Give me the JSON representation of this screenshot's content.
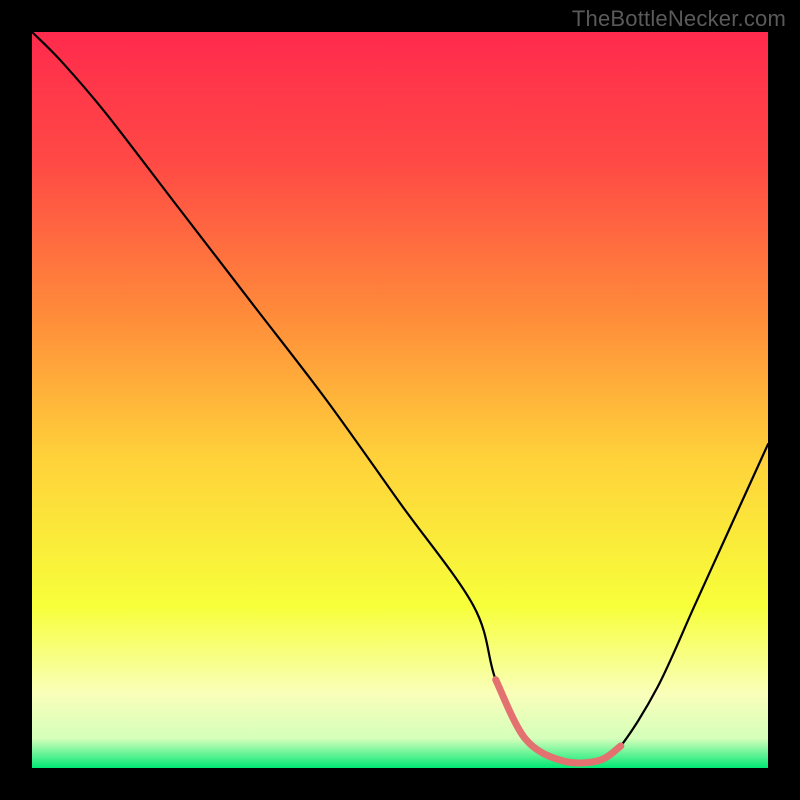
{
  "watermark": "TheBottleNecker.com",
  "colors": {
    "bg": "#000000",
    "gradient_top": "#ff2a4d",
    "gradient_mid_upper": "#ff6a3a",
    "gradient_mid": "#ffd23a",
    "gradient_lower": "#f7ff3a",
    "gradient_bottom_yellow": "#f9ffba",
    "gradient_bottom_green": "#00e874",
    "curve": "#000000",
    "emphasis": "#e2716f"
  },
  "chart_data": {
    "type": "line",
    "title": "",
    "xlabel": "",
    "ylabel": "",
    "xlim": [
      0,
      100
    ],
    "ylim": [
      0,
      100
    ],
    "series": [
      {
        "name": "bottleneck-curve",
        "x": [
          0,
          4,
          10,
          20,
          30,
          40,
          50,
          60,
          63,
          67,
          72,
          77,
          80,
          85,
          90,
          95,
          100
        ],
        "y": [
          100,
          96,
          89,
          76,
          63,
          50,
          36,
          22,
          12,
          4,
          1,
          1,
          3,
          11,
          22,
          33,
          44
        ]
      }
    ],
    "emphasis_segment": {
      "series": "bottleneck-curve",
      "x_start": 63,
      "x_end": 80
    }
  }
}
